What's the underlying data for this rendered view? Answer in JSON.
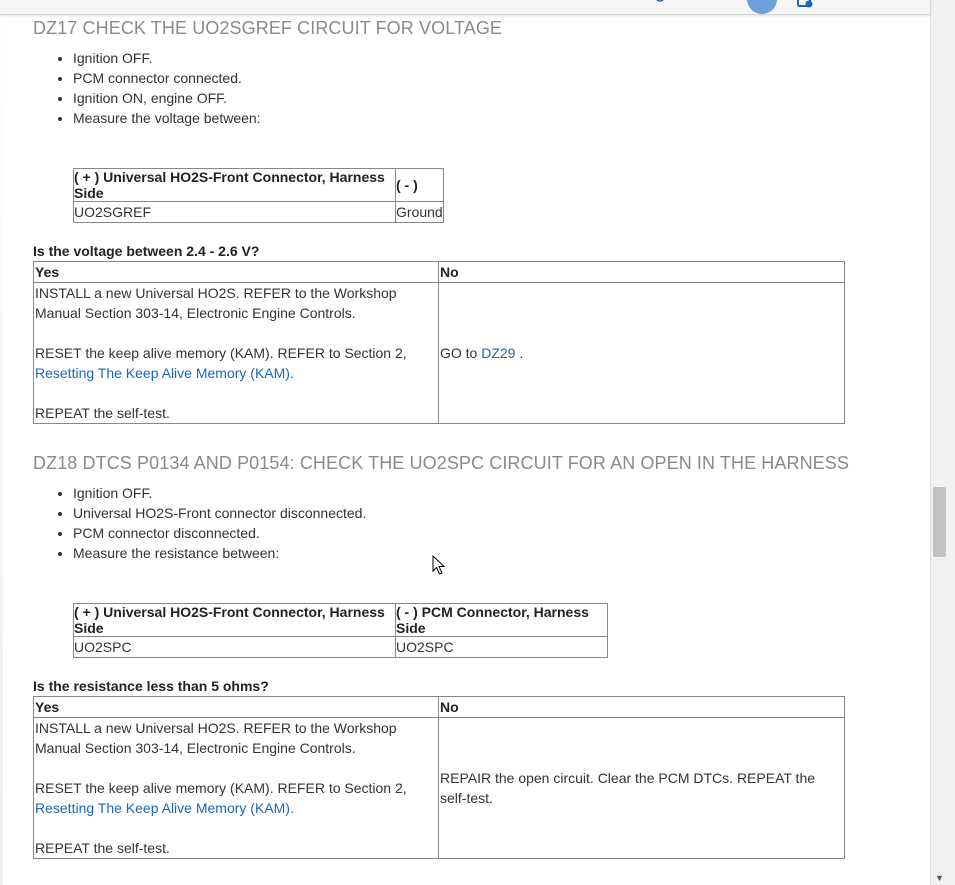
{
  "section1": {
    "heading": "DZ17 CHECK THE UO2SGREF CIRCUIT FOR VOLTAGE",
    "steps": [
      "Ignition OFF.",
      "PCM connector connected.",
      "Ignition ON, engine OFF.",
      "Measure the voltage between:"
    ],
    "measure_table": {
      "headers": [
        "( + ) Universal HO2S-Front Connector, Harness Side",
        "( - )"
      ],
      "row": [
        "UO2SGREF",
        "Ground"
      ]
    },
    "question": "Is the voltage between 2.4 - 2.6 V?",
    "answer_table": {
      "yes_header": "Yes",
      "no_header": "No",
      "yes_line1": "INSTALL a new Universal HO2S. REFER to the Workshop Manual Section 303-14, Electronic Engine Controls.",
      "yes_line2_prefix": "RESET the keep alive memory (KAM). REFER to Section 2, ",
      "yes_line2_link": "Resetting The Keep Alive Memory (KAM).",
      "yes_line3": "REPEAT the self-test.",
      "no_prefix": "GO to ",
      "no_link": "DZ29",
      "no_suffix": " ."
    }
  },
  "section2": {
    "heading": "DZ18 DTCS P0134 AND P0154: CHECK THE UO2SPC CIRCUIT FOR AN OPEN IN THE HARNESS",
    "steps": [
      "Ignition OFF.",
      "Universal HO2S-Front connector disconnected.",
      "PCM connector disconnected.",
      "Measure the resistance between:"
    ],
    "measure_table": {
      "headers": [
        "( + ) Universal HO2S-Front Connector, Harness Side",
        "( - ) PCM Connector, Harness Side"
      ],
      "row": [
        "UO2SPC",
        "UO2SPC"
      ]
    },
    "question": "Is the resistance less than 5 ohms?",
    "answer_table": {
      "yes_header": "Yes",
      "no_header": "No",
      "yes_line1": "INSTALL a new Universal HO2S. REFER to the Workshop Manual Section 303-14, Electronic Engine Controls.",
      "yes_line2_prefix": "RESET the keep alive memory (KAM). REFER to Section 2, ",
      "yes_line2_link": "Resetting The Keep Alive Memory (KAM).",
      "yes_line3": "REPEAT the self-test.",
      "no_text": "REPAIR the open circuit. Clear the PCM DTCs. REPEAT the self-test."
    }
  },
  "icons": {
    "account": "avatar",
    "toolbar": "app-icon",
    "scroll_down": "scroll-down-arrow"
  },
  "colors": {
    "link": "#1a66b8",
    "heading": "#8a8a8a",
    "avatar": "#6f9fd8"
  }
}
